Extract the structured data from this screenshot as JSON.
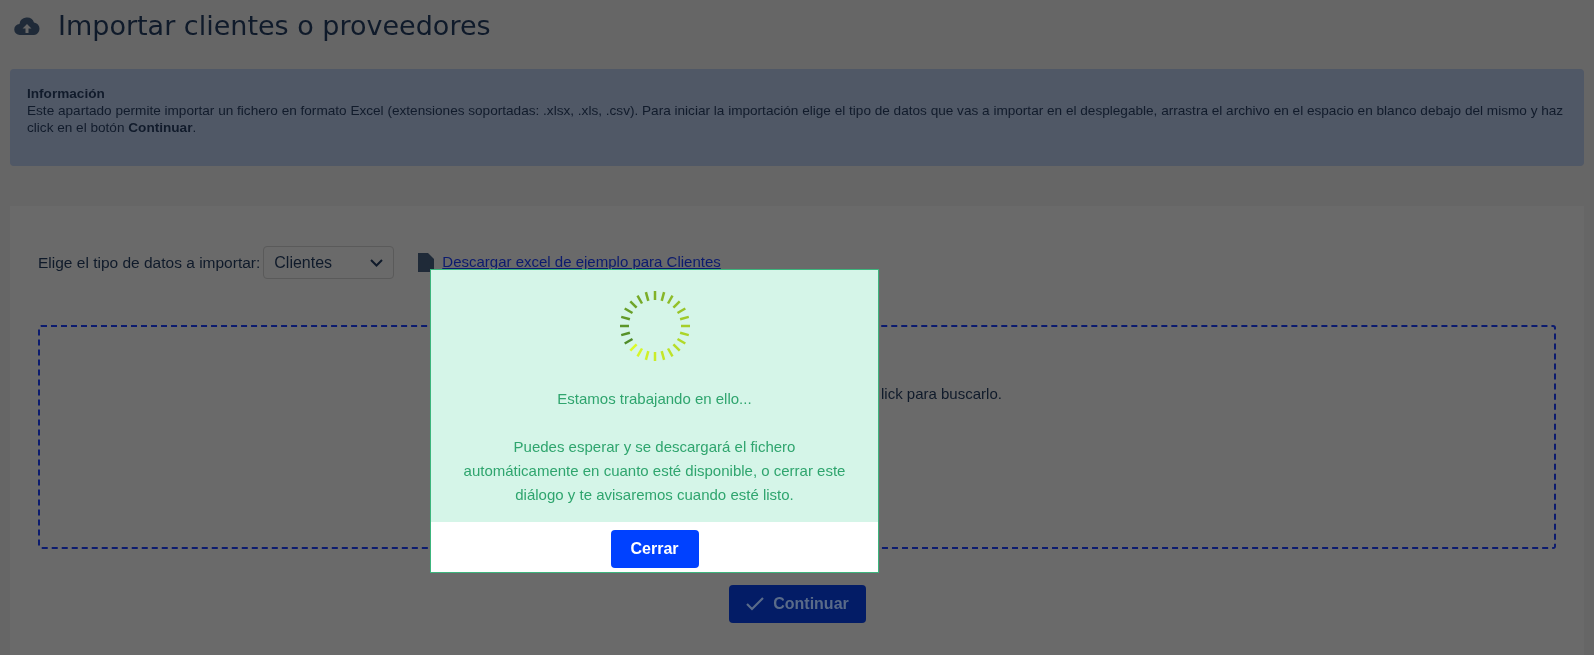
{
  "page": {
    "title": "Importar clientes o proveedores"
  },
  "info": {
    "heading": "Información",
    "text": "Este apartado permite importar un fichero en formato Excel (extensiones soportadas: .xlsx, .xls, .csv). Para iniciar la importación elige el tipo de datos que vas a importar en el desplegable, arrastra el archivo en el espacio en blanco debajo del mismo y haz click en el botón **Continuar**."
  },
  "form": {
    "label": "Elige el tipo de datos a importar:",
    "select_value": "Clientes",
    "download_link": "Descargar excel de ejemplo para Clientes"
  },
  "dropzone": {
    "text": "lick para buscarlo."
  },
  "continue_button": {
    "label": "Continuar"
  },
  "modal": {
    "message": "Estamos trabajando en ello...",
    "detail": "Puedes esperar y se descargará el fichero automáticamente en cuanto esté disponible, o cerrar este diálogo y te avisaremos cuando esté listo.",
    "button": "Cerrar"
  }
}
